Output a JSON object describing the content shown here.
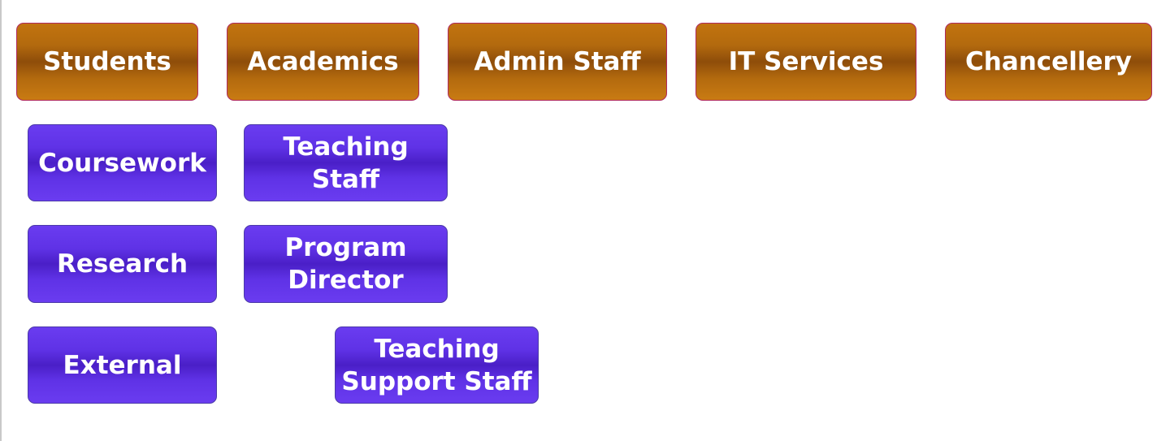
{
  "categories": [
    {
      "label": "Students"
    },
    {
      "label": "Academics"
    },
    {
      "label": "Admin Staff"
    },
    {
      "label": "IT Services"
    },
    {
      "label": "Chancellery"
    }
  ],
  "students_items": [
    {
      "label": "Coursework"
    },
    {
      "label": "Research"
    },
    {
      "label": "External"
    }
  ],
  "academics_items": [
    {
      "line1": "Teaching",
      "line2": "Staff"
    },
    {
      "line1": "Program",
      "line2": "Director"
    },
    {
      "line1": "Teaching",
      "line2": "Support Staff"
    }
  ],
  "colors": {
    "category_fill": "#b36a0e",
    "category_border": "#b02a60",
    "item_fill": "#5a2ee0",
    "item_border": "#4b3aa8",
    "text": "#ffffff"
  }
}
